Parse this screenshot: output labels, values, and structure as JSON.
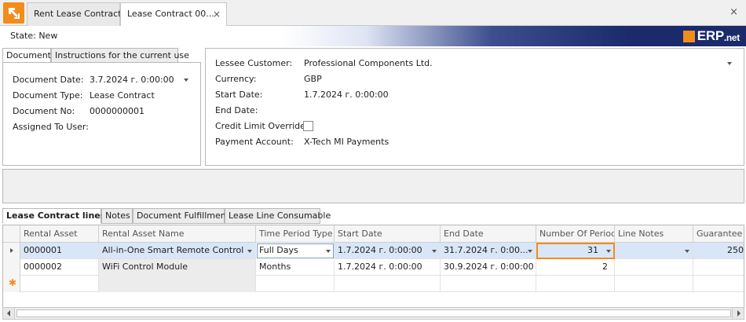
{
  "window": {
    "tabs": [
      {
        "label": "Rent Lease Contracts"
      },
      {
        "label": "Lease Contract 00...",
        "close": "×"
      }
    ],
    "close_glyph": "×"
  },
  "state": {
    "label": "State: New",
    "brand": "ERP",
    "brand_suffix": ".net"
  },
  "section_tabs": [
    "Document",
    "Instructions for the current use"
  ],
  "document": {
    "date_label": "Document Date:",
    "date_value": "3.7.2024 г. 0:00:00",
    "type_label": "Document Type:",
    "type_value": "Lease Contract",
    "no_label": "Document No:",
    "no_value": "0000000001",
    "user_label": "Assigned To User:",
    "user_value": ""
  },
  "customer": {
    "lessee_label": "Lessee Customer:",
    "lessee_value": "Professional Components Ltd.",
    "currency_label": "Currency:",
    "currency_value": "GBP",
    "start_label": "Start Date:",
    "start_value": "1.7.2024 г. 0:00:00",
    "end_label": "End Date:",
    "end_value": "",
    "credit_label": "Credit Limit Override:",
    "credit_checked": false,
    "payment_label": "Payment Account:",
    "payment_value": "X-Tech MI Payments"
  },
  "line_tabs": [
    "Lease Contract lines",
    "Notes",
    "Document Fulfillments",
    "Lease Line Consumable"
  ],
  "grid": {
    "columns": [
      "Rental Asset",
      "Rental Asset Name",
      "Time Period Type",
      "Start Date",
      "End Date",
      "Number Of Periods",
      "Line Notes",
      "Guarantee A"
    ],
    "rows": [
      {
        "asset": "0000001",
        "name": "All-in-One Smart Remote Control",
        "period_type": "Full Days",
        "start": "1.7.2024 г. 0:00:00",
        "end": "31.7.2024 г. 0:00...",
        "periods": "31",
        "notes": "",
        "guarantee": "250"
      },
      {
        "asset": "0000002",
        "name": "WiFi Control Module",
        "period_type": "Months",
        "start": "1.7.2024 г. 0:00:00",
        "end": "30.9.2024 г. 0:00:00",
        "periods": "2",
        "notes": "",
        "guarantee": ""
      }
    ],
    "new_row_marker": "✱"
  },
  "colors": {
    "accent": "#f28c1c",
    "banner": "#1a2a6b",
    "selected_row": "#d9e6f7"
  }
}
